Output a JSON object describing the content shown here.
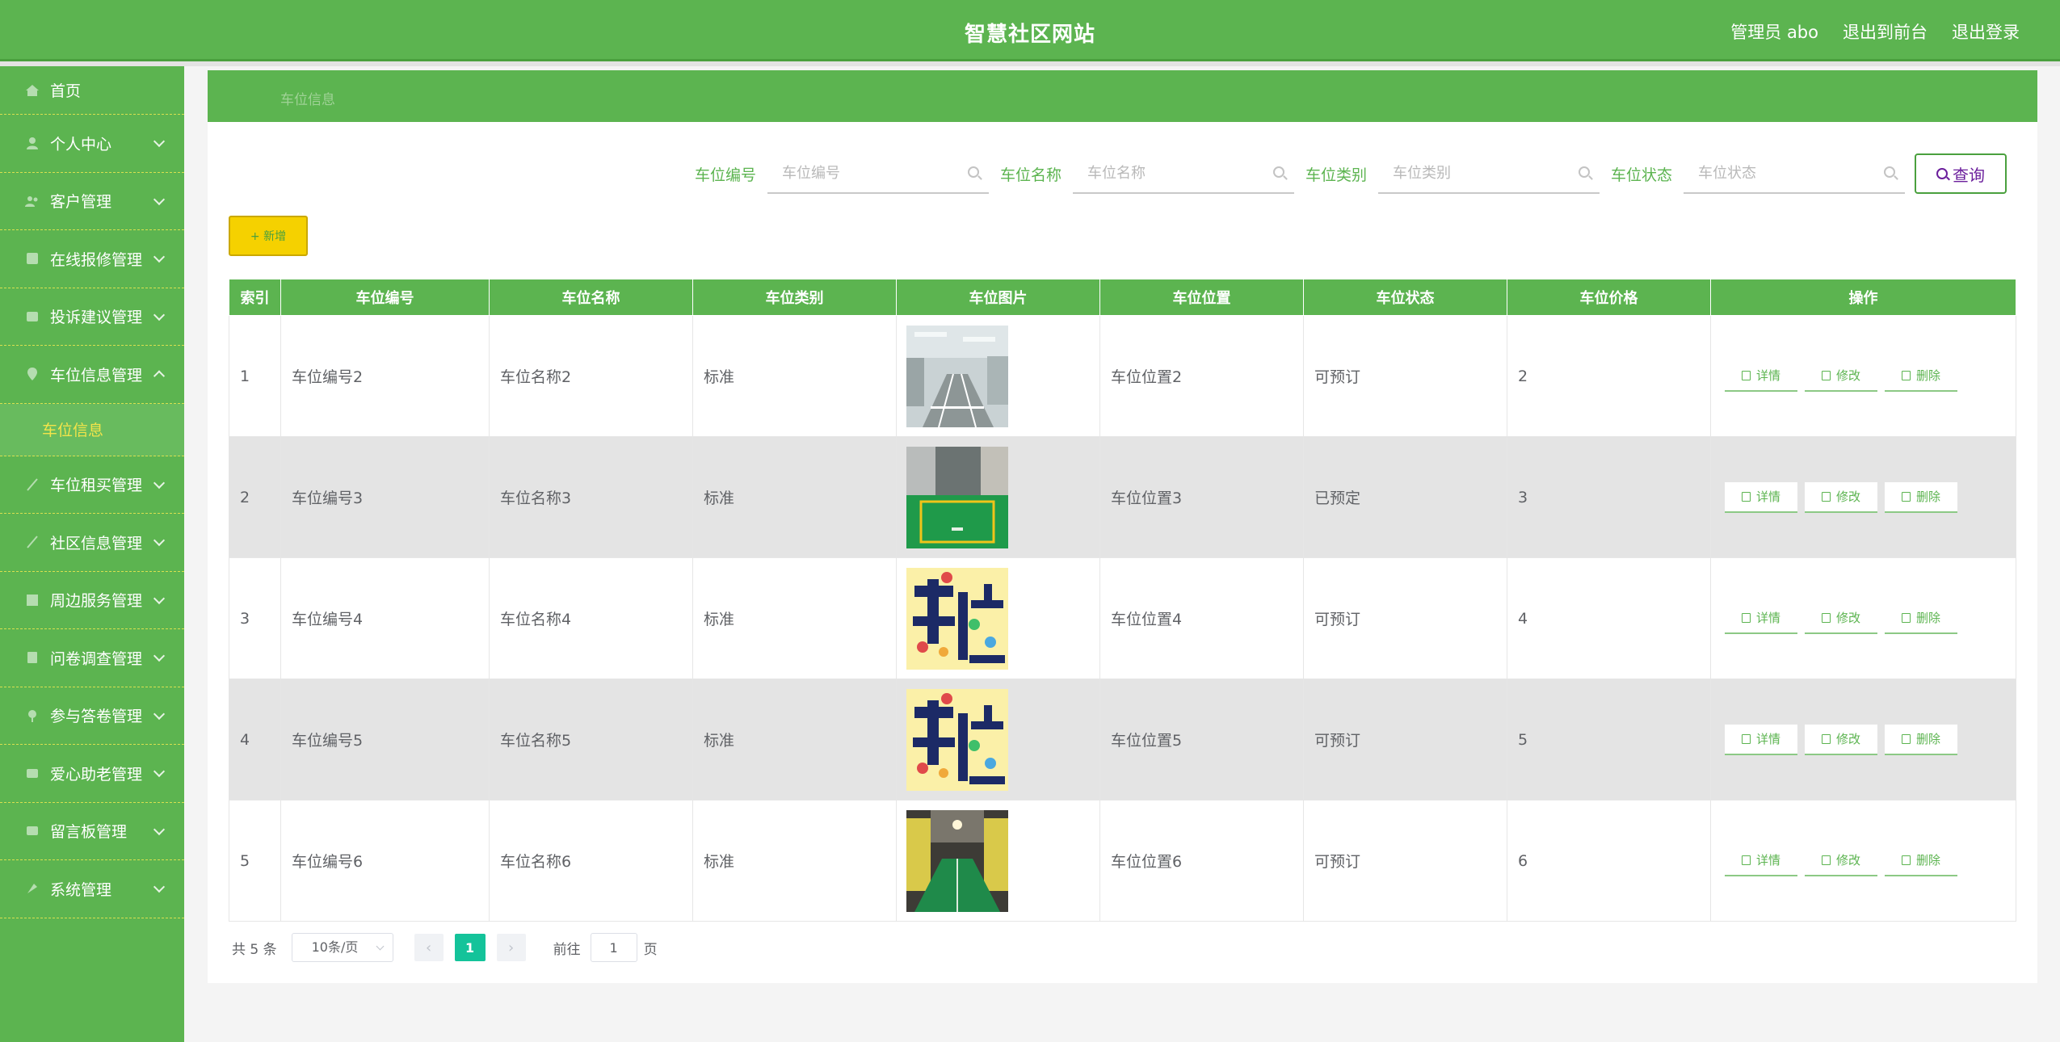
{
  "app": {
    "title": "智慧社区网站",
    "user_label": "管理员 abo",
    "front_link": "退出到前台",
    "logout_link": "退出登录"
  },
  "sidebar": {
    "items": [
      {
        "label": "首页",
        "icon": "home-icon"
      },
      {
        "label": "个人中心",
        "icon": "user-icon"
      },
      {
        "label": "客户管理",
        "icon": "customer-icon"
      },
      {
        "label": "在线报修管理",
        "icon": "repair-icon"
      },
      {
        "label": "投诉建议管理",
        "icon": "complaint-icon"
      },
      {
        "label": "车位信息管理",
        "icon": "parking-icon",
        "expanded": true
      },
      {
        "label": "车位租买管理",
        "icon": "rent-icon"
      },
      {
        "label": "社区信息管理",
        "icon": "community-icon"
      },
      {
        "label": "周边服务管理",
        "icon": "service-icon"
      },
      {
        "label": "问卷调查管理",
        "icon": "survey-icon"
      },
      {
        "label": "参与答卷管理",
        "icon": "answer-icon"
      },
      {
        "label": "爱心助老管理",
        "icon": "heart-icon"
      },
      {
        "label": "留言板管理",
        "icon": "message-icon"
      },
      {
        "label": "系统管理",
        "icon": "system-icon"
      }
    ],
    "sub_item": "车位信息"
  },
  "breadcrumb": "车位信息",
  "search": {
    "fields": [
      {
        "label": "车位编号",
        "placeholder": "车位编号"
      },
      {
        "label": "车位名称",
        "placeholder": "车位名称"
      },
      {
        "label": "车位类别",
        "placeholder": "车位类别"
      },
      {
        "label": "车位状态",
        "placeholder": "车位状态"
      }
    ],
    "query_label": "查询"
  },
  "add_label": "+ 新增",
  "table": {
    "headers": [
      "索引",
      "车位编号",
      "车位名称",
      "车位类别",
      "车位图片",
      "车位位置",
      "车位状态",
      "车位价格",
      "操作"
    ],
    "rows": [
      {
        "index": "1",
        "code": "车位编号2",
        "name": "车位名称2",
        "category": "标准",
        "image": "garage-photo",
        "location": "车位位置2",
        "status": "可预订",
        "price": "2"
      },
      {
        "index": "2",
        "code": "车位编号3",
        "name": "车位名称3",
        "category": "标准",
        "image": "green-bay-photo",
        "location": "车位位置3",
        "status": "已预定",
        "price": "3"
      },
      {
        "index": "3",
        "code": "车位编号4",
        "name": "车位名称4",
        "category": "标准",
        "image": "parking-sign-illustration",
        "location": "车位位置4",
        "status": "可预订",
        "price": "4"
      },
      {
        "index": "4",
        "code": "车位编号5",
        "name": "车位名称5",
        "category": "标准",
        "image": "parking-sign-illustration",
        "location": "车位位置5",
        "status": "可预订",
        "price": "5"
      },
      {
        "index": "5",
        "code": "车位编号6",
        "name": "车位名称6",
        "category": "标准",
        "image": "garage-photo-dark",
        "location": "车位位置6",
        "status": "可预订",
        "price": "6"
      }
    ],
    "actions": {
      "detail": "详情",
      "edit": "修改",
      "delete": "删除"
    }
  },
  "pagination": {
    "total_label": "共 5 条",
    "page_size": "10条/页",
    "current_page": "1",
    "goto_label": "前往",
    "goto_value": "1",
    "page_suffix": "页"
  },
  "colors": {
    "brand_green": "#5cb450",
    "accent_yellow": "#f5d100",
    "pager_active": "#14c39a"
  }
}
